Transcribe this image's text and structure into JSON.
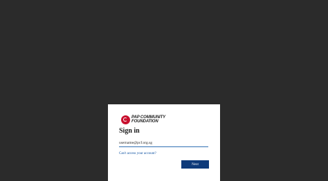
{
  "logo": {
    "line1": "PAP COMMUNITY",
    "line2": "FOUNDATION"
  },
  "signin": {
    "title": "Sign in",
    "username_value": "username@pcf.org.sg",
    "cant_access_link": "Can't access your account?",
    "next_label": "Next"
  },
  "colors": {
    "page_background": "#2b2b2b",
    "card_background": "#ffffff",
    "brand_red": "#c8102e",
    "link_blue": "#0b4fa0",
    "button_blue": "#0e3a7a"
  }
}
